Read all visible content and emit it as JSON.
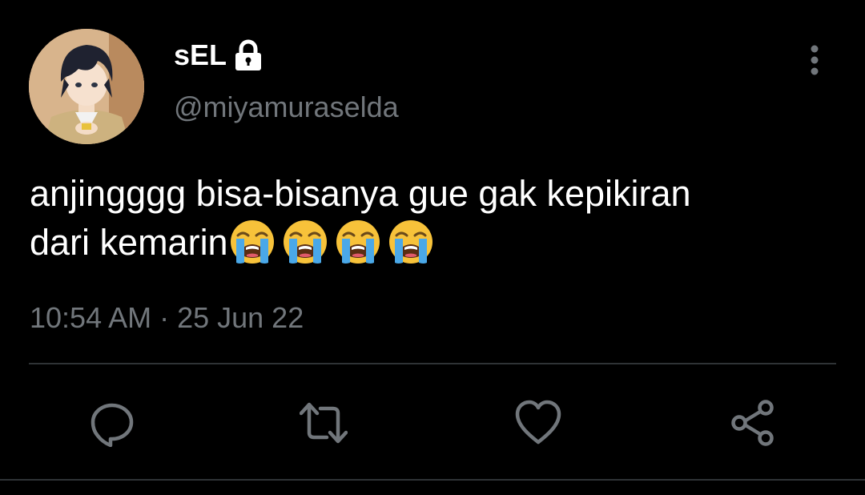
{
  "author": {
    "display_name": "sEL",
    "handle": "@miyamuraselda",
    "protected": true,
    "avatar": "anime-boy-avatar"
  },
  "tweet": {
    "text_line1": "anjingggg bisa-bisanya gue gak kepikiran",
    "text_line2": "dari kemarin",
    "emojis": [
      "loudly-crying-face",
      "loudly-crying-face",
      "loudly-crying-face",
      "loudly-crying-face"
    ],
    "timestamp": "10:54 AM · 25 Jun 22"
  },
  "actions": [
    {
      "name": "reply",
      "icon": "reply-icon"
    },
    {
      "name": "retweet",
      "icon": "retweet-icon"
    },
    {
      "name": "like",
      "icon": "heart-icon"
    },
    {
      "name": "share",
      "icon": "share-icon"
    }
  ],
  "colors": {
    "background": "#000000",
    "text_primary": "#ffffff",
    "text_secondary": "#71767b",
    "divider": "#2f3336",
    "emoji_yellow": "#f7c23a",
    "emoji_tears": "#4aa8e8"
  }
}
